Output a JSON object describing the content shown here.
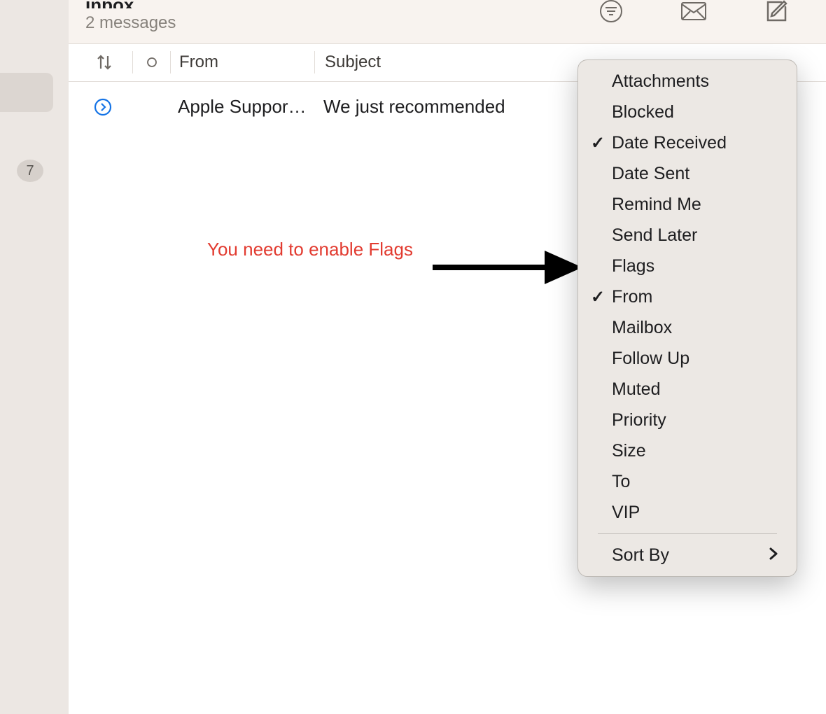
{
  "toolbar": {
    "title": "Inbox",
    "messageCount": "2 messages"
  },
  "sidebar": {
    "badgeCount": "7"
  },
  "columns": {
    "from": "From",
    "subject": "Subject"
  },
  "message": {
    "from": "Apple Suppor…",
    "subject": "We just recommended"
  },
  "annotation": {
    "text": "You need to enable Flags"
  },
  "contextMenu": {
    "items": [
      {
        "label": "Attachments",
        "checked": false
      },
      {
        "label": "Blocked",
        "checked": false
      },
      {
        "label": "Date Received",
        "checked": true
      },
      {
        "label": "Date Sent",
        "checked": false
      },
      {
        "label": "Remind Me",
        "checked": false
      },
      {
        "label": "Send Later",
        "checked": false
      },
      {
        "label": "Flags",
        "checked": false
      },
      {
        "label": "From",
        "checked": true
      },
      {
        "label": "Mailbox",
        "checked": false
      },
      {
        "label": "Follow Up",
        "checked": false
      },
      {
        "label": "Muted",
        "checked": false
      },
      {
        "label": "Priority",
        "checked": false
      },
      {
        "label": "Size",
        "checked": false
      },
      {
        "label": "To",
        "checked": false
      },
      {
        "label": "VIP",
        "checked": false
      }
    ],
    "sortBy": "Sort By"
  }
}
